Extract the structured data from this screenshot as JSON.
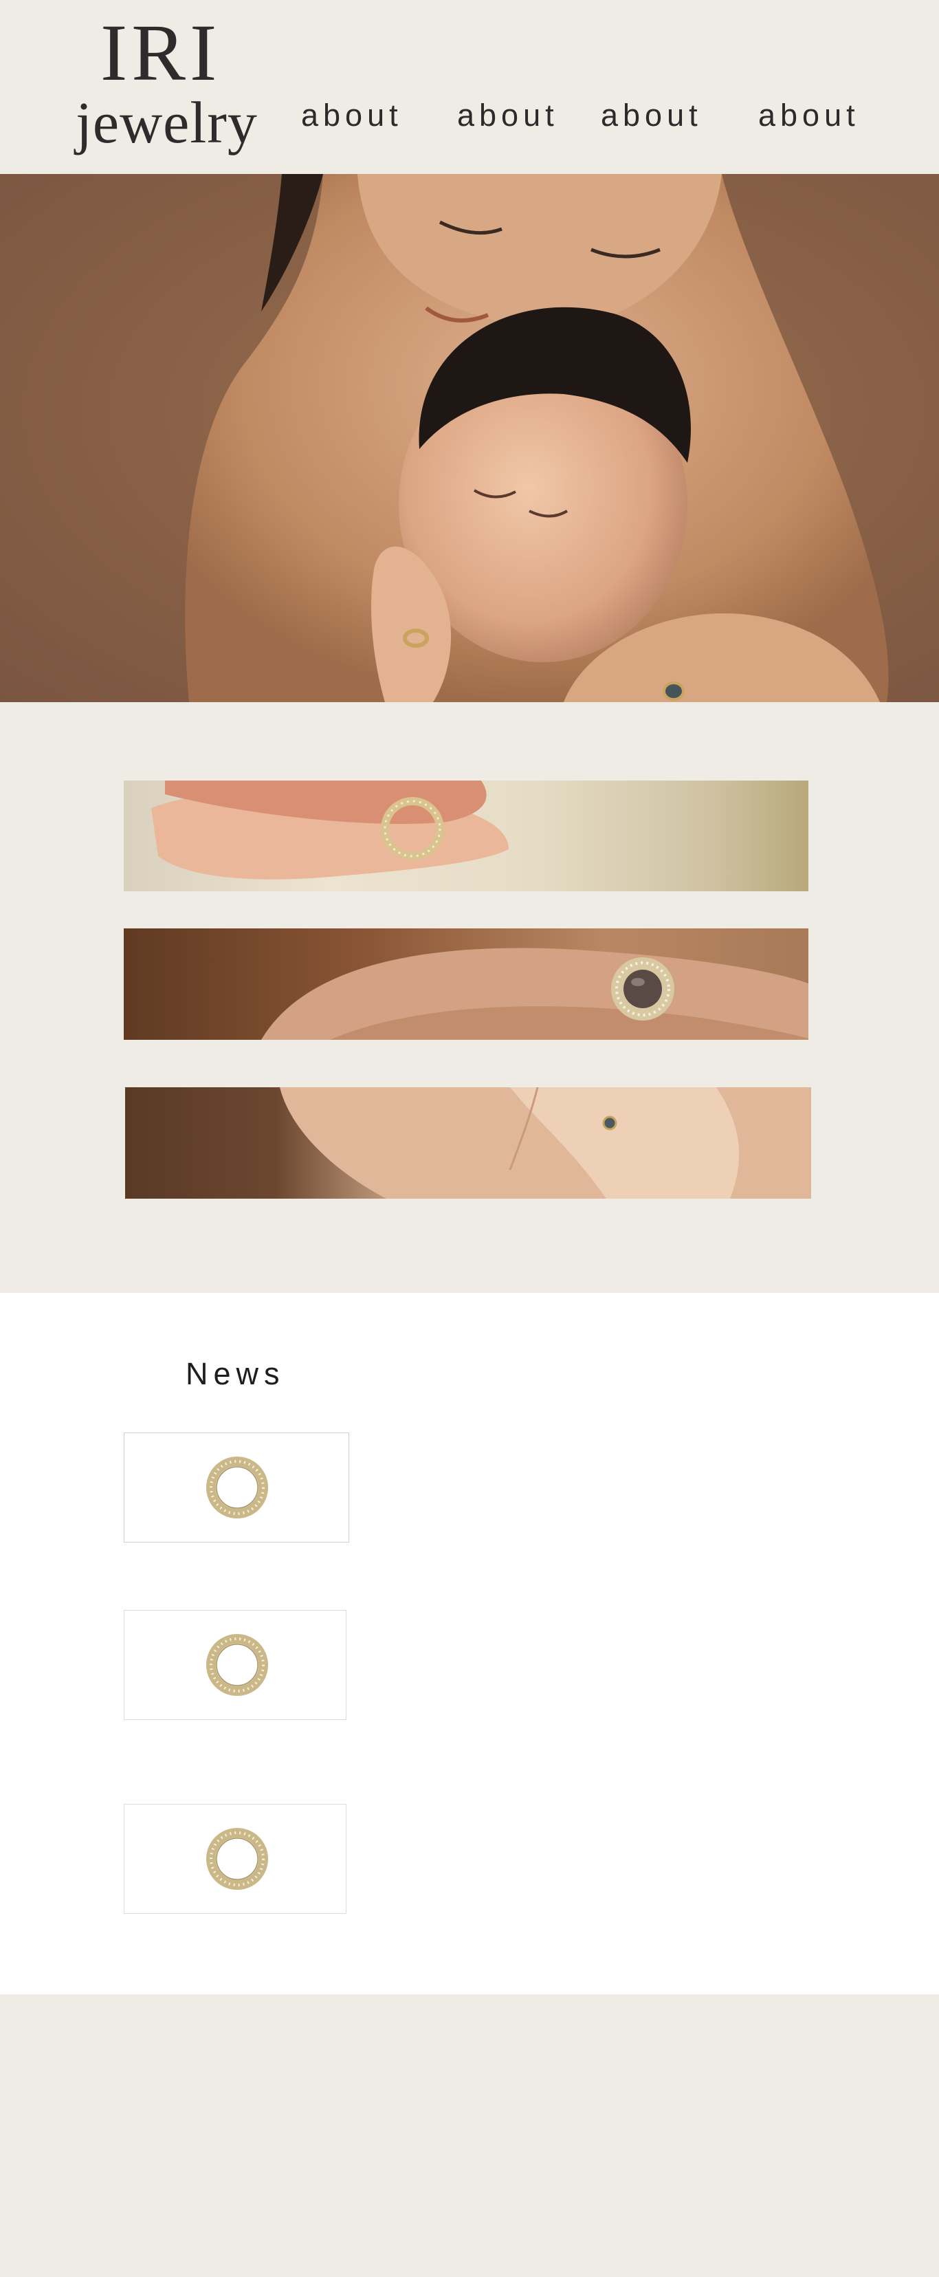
{
  "brand": {
    "logo_top": "IRI",
    "logo_bottom": "jewelry"
  },
  "nav": {
    "items": [
      {
        "label": "about"
      },
      {
        "label": "about"
      },
      {
        "label": "about"
      },
      {
        "label": "about"
      }
    ]
  },
  "hero": {
    "image": "mother-holding-newborn-photo"
  },
  "feature_strips": [
    {
      "image": "baby-hand-with-ring-strip"
    },
    {
      "image": "hand-with-stone-ring-strip"
    },
    {
      "image": "hands-holding-baby-strip"
    }
  ],
  "news": {
    "title": "News",
    "items": [
      {
        "image": "diamond-halo-ring-icon"
      },
      {
        "image": "diamond-halo-ring-icon"
      },
      {
        "image": "diamond-halo-ring-icon"
      }
    ]
  },
  "colors": {
    "background": "#efebe5",
    "text": "#2b2b2b",
    "card_border": "#cfcfcf",
    "gold": "#c9b582"
  }
}
